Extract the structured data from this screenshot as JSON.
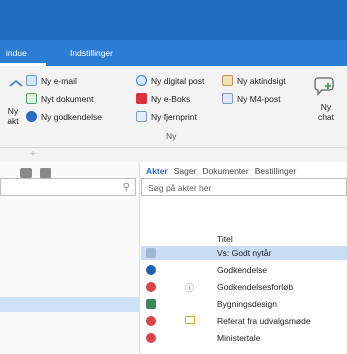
{
  "tabs": {
    "window": "indue",
    "settings": "Indstillinger"
  },
  "ribbon": {
    "new_act": "Ny akt",
    "new_email": "Ny e-mail",
    "new_document": "Nyt dokument",
    "new_approval": "Ny godkendelse",
    "new_digital_post": "Ny digital post",
    "new_eboks": "Ny e-Boks",
    "new_remote_print": "Ny fjernprint",
    "new_access_request": "Ny aktindsigt",
    "new_m4_post": "Ny M4-post",
    "new_chat": "Ny chat",
    "group_label": "Ny"
  },
  "panel": {
    "tabs": [
      "Akter",
      "Sager",
      "Dokumenter",
      "Bestillinger"
    ],
    "search_placeholder": "Søg på akter her",
    "column_title": "Titel",
    "rows": [
      "Vs: Godt nytår",
      "Godkendelse",
      "Godkendelsesforløb",
      "Bygningsdesign",
      "Referat fra udvalgsmøde",
      "Ministertale"
    ]
  },
  "colors": {
    "accent": "#2b7cd3",
    "selection": "#c8dcf3",
    "red": "#d9454e",
    "blue": "#1f5fb0",
    "green": "#3a8a5a"
  }
}
